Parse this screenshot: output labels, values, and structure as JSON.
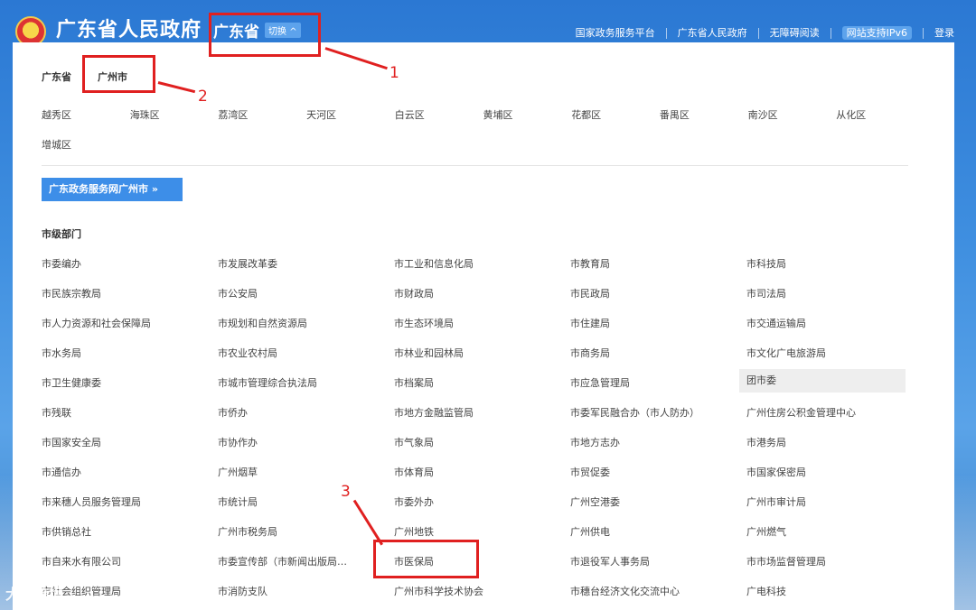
{
  "header": {
    "site_title": "广东省人民政府",
    "region": "广东省",
    "switch_label": "切换",
    "links": [
      "国家政务服务平台",
      "广东省人民政府",
      "无障碍阅读",
      "网站支持IPv6",
      "登录"
    ]
  },
  "panel": {
    "crumb_province": "广东省",
    "crumb_city": "广州市",
    "districts": [
      "越秀区",
      "海珠区",
      "荔湾区",
      "天河区",
      "白云区",
      "黄埔区",
      "花都区",
      "番禺区",
      "南沙区",
      "从化区",
      "增城区"
    ],
    "cta_label": "广东政务服务网广州市 »",
    "section_title": "市级部门",
    "departments": [
      "市委编办",
      "市发展改革委",
      "市工业和信息化局",
      "市教育局",
      "市科技局",
      "市民族宗教局",
      "市公安局",
      "市财政局",
      "市民政局",
      "市司法局",
      "市人力资源和社会保障局",
      "市规划和自然资源局",
      "市生态环境局",
      "市住建局",
      "市交通运输局",
      "市水务局",
      "市农业农村局",
      "市林业和园林局",
      "市商务局",
      "市文化广电旅游局",
      "市卫生健康委",
      "市城市管理综合执法局",
      "市档案局",
      "市应急管理局",
      "团市委",
      "市残联",
      "市侨办",
      "市地方金融监管局",
      "市委军民融合办（市人防办）",
      "广州住房公积金管理中心",
      "市国家安全局",
      "市协作办",
      "市气象局",
      "市地方志办",
      "市港务局",
      "市通信办",
      "广州烟草",
      "市体育局",
      "市贸促委",
      "市国家保密局",
      "市来穗人员服务管理局",
      "市统计局",
      "市委外办",
      "广州空港委",
      "广州市审计局",
      "市供销总社",
      "广州市税务局",
      "广州地铁",
      "广州供电",
      "广州燃气",
      "市自来水有限公司",
      "市委宣传部（市新闻出版局…",
      "市医保局",
      "市退役军人事务局",
      "市市场监督管理局",
      "市社会组织管理局",
      "市消防支队",
      "广州市科学技术协会",
      "市穗台经济文化交流中心",
      "广电科技"
    ]
  },
  "annotations": {
    "n1": "1",
    "n2": "2",
    "n3": "3"
  },
  "watermark": "大数跨境",
  "colors": {
    "accent": "#3d8ee8",
    "annotation": "#e02020"
  }
}
